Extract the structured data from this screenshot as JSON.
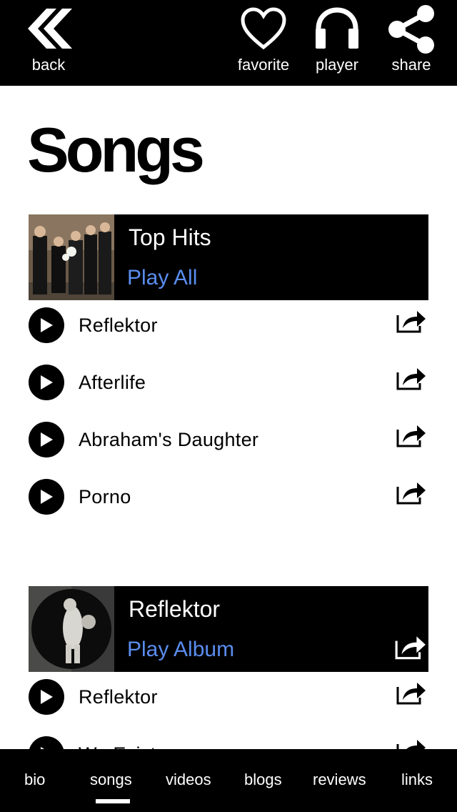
{
  "topbar": {
    "back_label": "back",
    "favorite_label": "favorite",
    "player_label": "player",
    "share_label": "share"
  },
  "page": {
    "title": "Songs"
  },
  "albums": [
    {
      "name": "Top Hits",
      "play_label": "Play All",
      "songs": [
        "Reflektor",
        "Afterlife",
        "Abraham's Daughter",
        "Porno"
      ]
    },
    {
      "name": "Reflektor",
      "play_label": "Play Album",
      "songs": [
        "Reflektor",
        "We Exist"
      ]
    }
  ],
  "bottom_nav": {
    "items": [
      "bio",
      "songs",
      "videos",
      "blogs",
      "reviews",
      "links"
    ],
    "active": "songs"
  },
  "colors": {
    "accent": "#5b8def",
    "bar": "#000000"
  },
  "icons": [
    "back-icon",
    "heart-icon",
    "headphones-icon",
    "share-icon",
    "play-icon",
    "share-box-icon"
  ]
}
